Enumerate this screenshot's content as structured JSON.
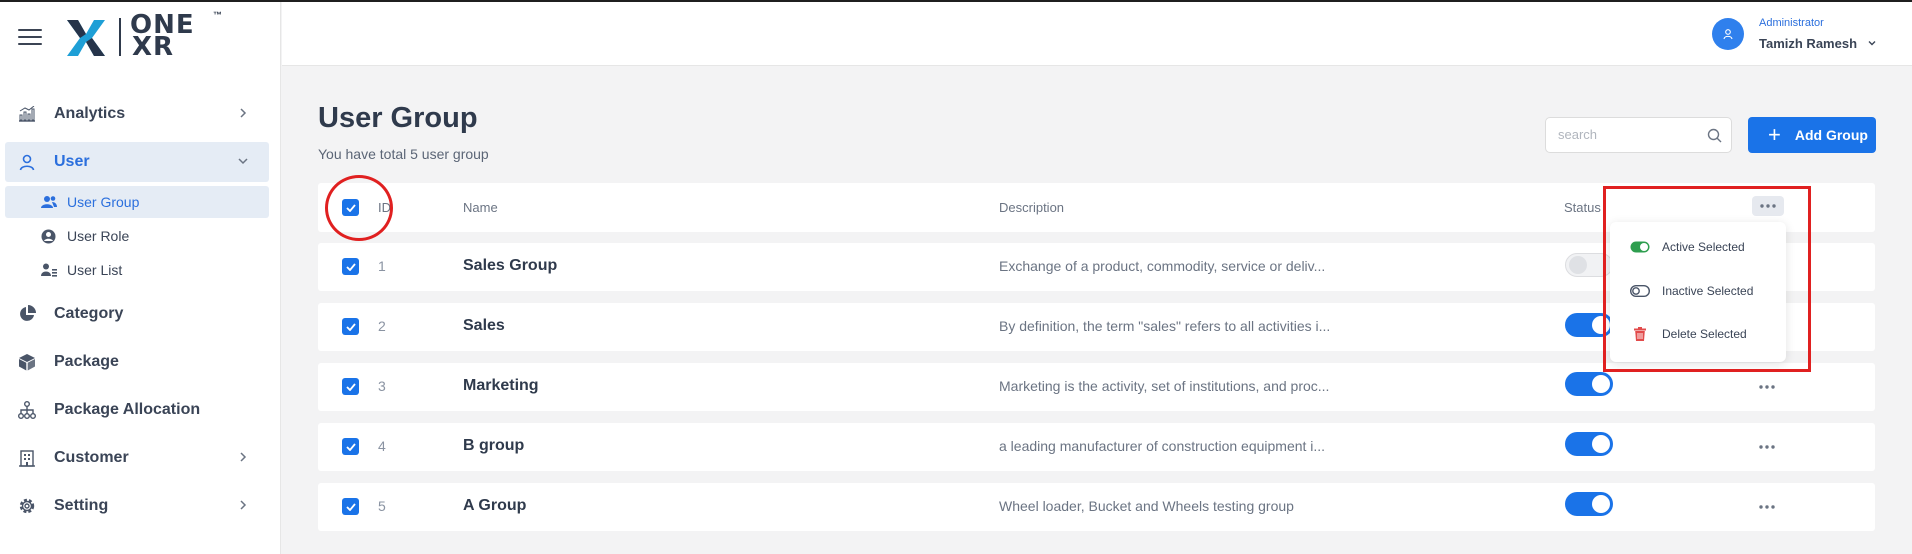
{
  "brand": {
    "logo_line1": "ONE",
    "logo_line2": "XR",
    "trademark": "™"
  },
  "sidebar": {
    "items": [
      {
        "label": "Analytics"
      },
      {
        "label": "User"
      },
      {
        "label": "Category"
      },
      {
        "label": "Package"
      },
      {
        "label": "Package Allocation"
      },
      {
        "label": "Customer"
      },
      {
        "label": "Setting"
      }
    ],
    "user_submenu": [
      {
        "label": "User Group"
      },
      {
        "label": "User Role"
      },
      {
        "label": "User List"
      }
    ]
  },
  "header": {
    "role": "Administrator",
    "user_name": "Tamizh Ramesh"
  },
  "page": {
    "title": "User Group",
    "subtitle": "You have total 5 user group",
    "search_placeholder": "search",
    "add_button": "Add Group"
  },
  "table": {
    "columns": {
      "id": "ID",
      "name": "Name",
      "description": "Description",
      "status": "Status"
    },
    "rows": [
      {
        "id": "1",
        "name": "Sales Group",
        "description": "Exchange of a product, commodity, service or deliv...",
        "status": "inactive"
      },
      {
        "id": "2",
        "name": "Sales",
        "description": "By definition, the term \"sales\" refers to all activities i...",
        "status": "active"
      },
      {
        "id": "3",
        "name": "Marketing",
        "description": "Marketing is the activity, set of institutions, and proc...",
        "status": "active"
      },
      {
        "id": "4",
        "name": "B group",
        "description": "a leading manufacturer of construction equipment i...",
        "status": "active"
      },
      {
        "id": "5",
        "name": "A Group",
        "description": "Wheel loader, Bucket and Wheels testing group",
        "status": "active"
      }
    ]
  },
  "bulk_menu": {
    "items": [
      {
        "label": "Active Selected"
      },
      {
        "label": "Inactive Selected"
      },
      {
        "label": "Delete Selected"
      }
    ]
  },
  "colors": {
    "accent": "#1a73e8",
    "annotation": "#e02020",
    "success": "#2e9e4f",
    "danger": "#e24b4b"
  }
}
